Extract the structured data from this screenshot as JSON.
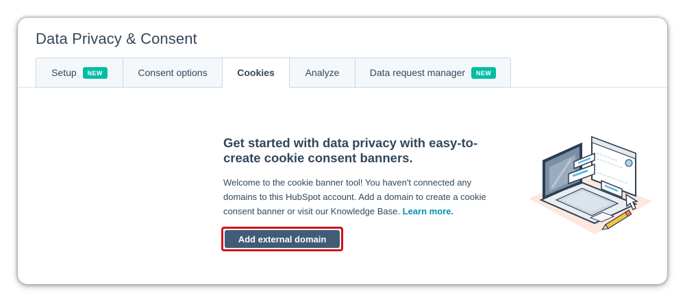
{
  "page": {
    "title": "Data Privacy & Consent"
  },
  "tabs": [
    {
      "label": "Setup",
      "badge": "NEW",
      "active": false
    },
    {
      "label": "Consent options",
      "badge": "",
      "active": false
    },
    {
      "label": "Cookies",
      "badge": "",
      "active": true
    },
    {
      "label": "Analyze",
      "badge": "",
      "active": false
    },
    {
      "label": "Data request manager",
      "badge": "NEW",
      "active": false
    }
  ],
  "empty_state": {
    "heading": "Get started with data privacy with easy-to-create cookie consent banners.",
    "body": "Welcome to the cookie banner tool! You haven't connected any domains to this HubSpot account. Add a domain to create a cookie consent banner or visit our Knowledge Base.",
    "link_label": "Learn more.",
    "button_label": "Add external domain",
    "illustration_icon": "laptop-cookie-banner-illustration"
  },
  "colors": {
    "text": "#33475b",
    "badge": "#00bda5",
    "link": "#0091ae",
    "button": "#425b76",
    "highlight": "#d0101a"
  }
}
